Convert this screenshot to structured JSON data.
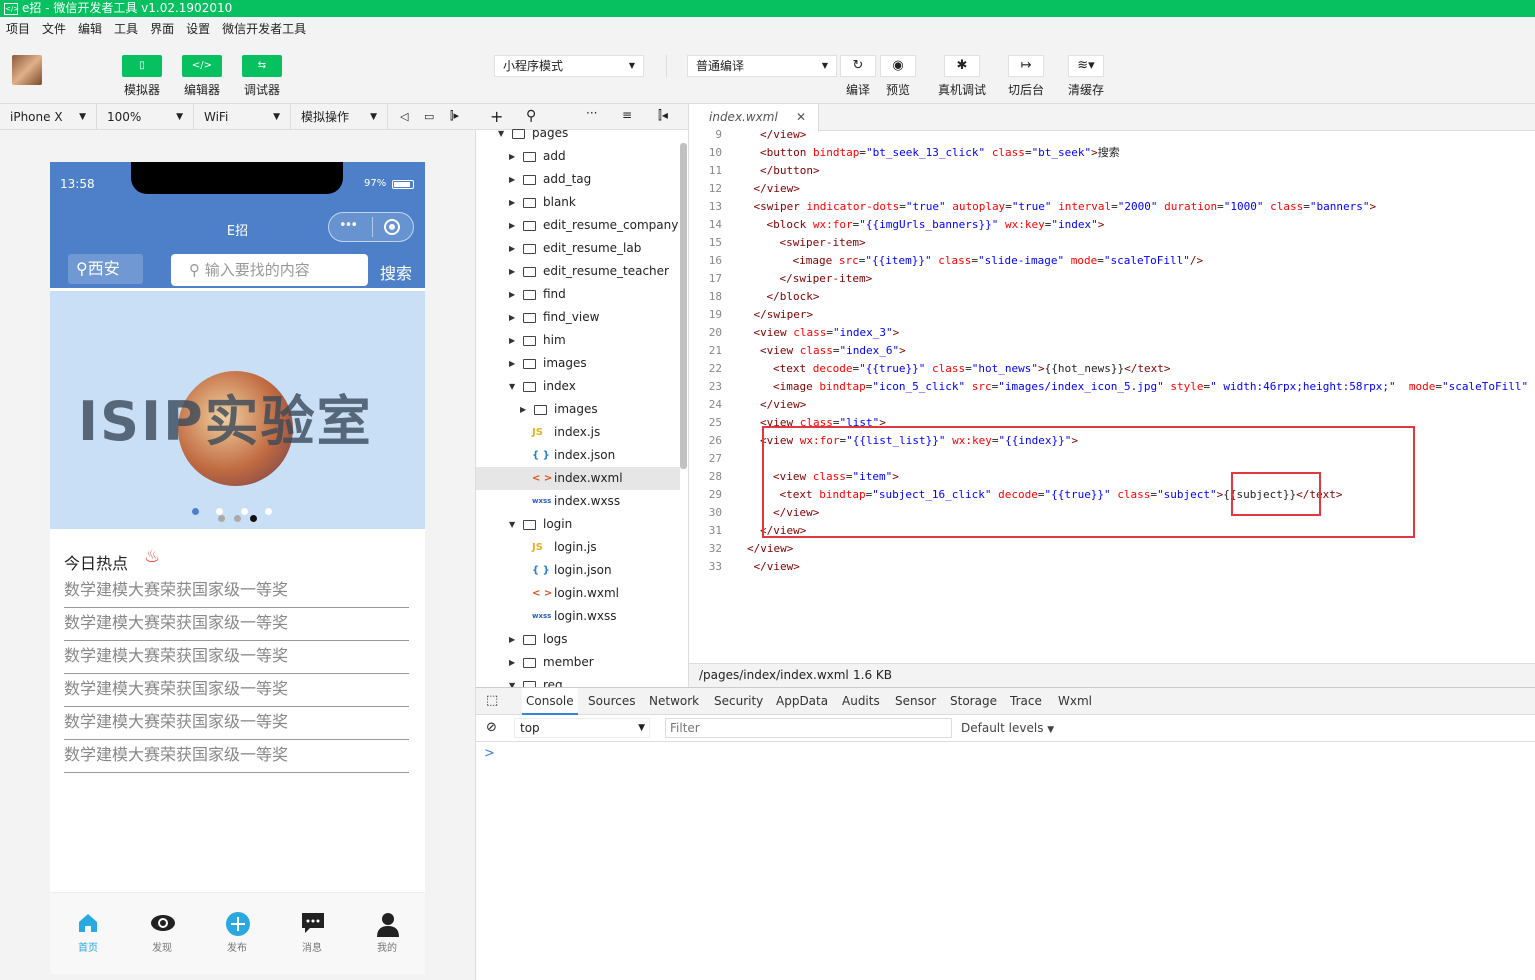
{
  "window": {
    "title": "e招 - 微信开发者工具 v1.02.1902010"
  },
  "menu": [
    "项目",
    "文件",
    "编辑",
    "工具",
    "界面",
    "设置",
    "微信开发者工具"
  ],
  "toolbar": {
    "simulator": "模拟器",
    "editor": "编辑器",
    "debugger": "调试器",
    "mode": "小程序模式",
    "compile_mode": "普通编译",
    "compile": "编译",
    "preview": "预览",
    "remote_debug": "真机调试",
    "background": "切后台",
    "clear_cache": "清缓存"
  },
  "simbar": {
    "device": "iPhone X",
    "zoom": "100%",
    "network": "WiFi",
    "ops": "模拟操作"
  },
  "phone": {
    "time": "13:58",
    "battery": "97%",
    "nav_title": "E招",
    "city": "西安",
    "search_placeholder": "输入要找的内容",
    "search_button": "搜索",
    "banner_text": "ISIP实验室",
    "hot_title": "今日热点",
    "news": [
      "数学建模大赛荣获国家级一等奖",
      "数学建模大赛荣获国家级一等奖",
      "数学建模大赛荣获国家级一等奖",
      "数学建模大赛荣获国家级一等奖",
      "数学建模大赛荣获国家级一等奖",
      "数学建模大赛荣获国家级一等奖"
    ],
    "tabs": [
      "首页",
      "发现",
      "发布",
      "消息",
      "我的"
    ],
    "accent": "#4d80c8",
    "tab_active": "#1aad19"
  },
  "tree": [
    {
      "name": "pages",
      "type": "folder",
      "open": true,
      "depth": 0
    },
    {
      "name": "add",
      "type": "folder",
      "open": false,
      "depth": 1
    },
    {
      "name": "add_tag",
      "type": "folder",
      "open": false,
      "depth": 1
    },
    {
      "name": "blank",
      "type": "folder",
      "open": false,
      "depth": 1
    },
    {
      "name": "edit_resume_company",
      "type": "folder",
      "open": false,
      "depth": 1
    },
    {
      "name": "edit_resume_lab",
      "type": "folder",
      "open": false,
      "depth": 1
    },
    {
      "name": "edit_resume_teacher",
      "type": "folder",
      "open": false,
      "depth": 1
    },
    {
      "name": "find",
      "type": "folder",
      "open": false,
      "depth": 1
    },
    {
      "name": "find_view",
      "type": "folder",
      "open": false,
      "depth": 1
    },
    {
      "name": "him",
      "type": "folder",
      "open": false,
      "depth": 1
    },
    {
      "name": "images",
      "type": "folder",
      "open": false,
      "depth": 1
    },
    {
      "name": "index",
      "type": "folder",
      "open": true,
      "depth": 1
    },
    {
      "name": "images",
      "type": "folder",
      "open": false,
      "depth": 2
    },
    {
      "name": "index.js",
      "type": "js",
      "depth": 2
    },
    {
      "name": "index.json",
      "type": "json",
      "depth": 2
    },
    {
      "name": "index.wxml",
      "type": "wxml",
      "depth": 2,
      "selected": true
    },
    {
      "name": "index.wxss",
      "type": "wxss",
      "depth": 2
    },
    {
      "name": "login",
      "type": "folder",
      "open": true,
      "depth": 1
    },
    {
      "name": "login.js",
      "type": "js",
      "depth": 2
    },
    {
      "name": "login.json",
      "type": "json",
      "depth": 2
    },
    {
      "name": "login.wxml",
      "type": "wxml",
      "depth": 2
    },
    {
      "name": "login.wxss",
      "type": "wxss",
      "depth": 2
    },
    {
      "name": "logs",
      "type": "folder",
      "open": false,
      "depth": 1
    },
    {
      "name": "member",
      "type": "folder",
      "open": false,
      "depth": 1
    },
    {
      "name": "reg",
      "type": "folder",
      "open": true,
      "depth": 1
    }
  ],
  "editor": {
    "tab": "index.wxml",
    "path": "/pages/index/index.wxml",
    "size": "1.6 KB",
    "lines": [
      {
        "n": "9",
        "indent": 2,
        "html": "<span class='t'>&lt;/view&gt;</span>"
      },
      {
        "n": "10",
        "indent": 2,
        "html": "<span class='t'>&lt;button</span> <span class='a'>bindtap</span>=<span class='v'>\"bt_seek_13_click\"</span> <span class='a'>class</span>=<span class='v'>\"bt_seek\"</span><span class='t'>&gt;</span>搜索"
      },
      {
        "n": "11",
        "indent": 2,
        "html": "<span class='t'>&lt;/button&gt;</span>"
      },
      {
        "n": "12",
        "indent": 1,
        "html": "<span class='t'>&lt;/view&gt;</span>"
      },
      {
        "n": "13",
        "indent": 1,
        "html": "<span class='t'>&lt;swiper</span> <span class='a'>indicator-dots</span>=<span class='v'>\"true\"</span> <span class='a'>autoplay</span>=<span class='v'>\"true\"</span> <span class='a'>interval</span>=<span class='v'>\"2000\"</span> <span class='a'>duration</span>=<span class='v'>\"1000\"</span> <span class='a'>class</span>=<span class='v'>\"banners\"</span><span class='t'>&gt;</span>"
      },
      {
        "n": "14",
        "indent": 3,
        "html": "<span class='t'>&lt;block</span> <span class='a'>wx:for</span>=<span class='v'>\"{{imgUrls_banners}}\"</span> <span class='a'>wx:key</span>=<span class='v'>\"index\"</span><span class='t'>&gt;</span>"
      },
      {
        "n": "15",
        "indent": 5,
        "html": "<span class='t'>&lt;swiper-item&gt;</span>"
      },
      {
        "n": "16",
        "indent": 7,
        "html": "<span class='t'>&lt;image</span> <span class='a'>src</span>=<span class='v'>\"{{item}}\"</span> <span class='a'>class</span>=<span class='v'>\"slide-image\"</span> <span class='a'>mode</span>=<span class='v'>\"scaleToFill\"</span><span class='t'>/&gt;</span>"
      },
      {
        "n": "17",
        "indent": 5,
        "html": "<span class='t'>&lt;/swiper-item&gt;</span>"
      },
      {
        "n": "18",
        "indent": 3,
        "html": "<span class='t'>&lt;/block&gt;</span>"
      },
      {
        "n": "19",
        "indent": 1,
        "html": "<span class='t'>&lt;/swiper&gt;</span>"
      },
      {
        "n": "20",
        "indent": 1,
        "html": "<span class='t'>&lt;view</span> <span class='a'>class</span>=<span class='v'>\"index_3\"</span><span class='t'>&gt;</span>"
      },
      {
        "n": "21",
        "indent": 2,
        "html": "<span class='t'>&lt;view</span> <span class='a'>class</span>=<span class='v'>\"index_6\"</span><span class='t'>&gt;</span>"
      },
      {
        "n": "22",
        "indent": 4,
        "html": "<span class='t'>&lt;text</span> <span class='a'>decode</span>=<span class='v'>\"{{true}}\"</span> <span class='a'>class</span>=<span class='v'>\"hot_news\"</span><span class='t'>&gt;</span>{{hot_news}}<span class='t'>&lt;/text&gt;</span>"
      },
      {
        "n": "23",
        "indent": 4,
        "html": "<span class='t'>&lt;image</span> <span class='a'>bindtap</span>=<span class='v'>\"icon_5_click\"</span> <span class='a'>src</span>=<span class='v'>\"images/index_icon_5.jpg\"</span> <span class='a'>style</span>=<span class='v'>\" width:46rpx;height:58rpx;\"</span>  <span class='a'>mode</span>=<span class='v'>\"scaleToFill\"</span>"
      },
      {
        "n": "24",
        "indent": 2,
        "html": "<span class='t'>&lt;/view&gt;</span>"
      },
      {
        "n": "25",
        "indent": 2,
        "html": "<span class='t'>&lt;view</span> <span class='a'>class</span>=<span class='v'>\"list\"</span><span class='t'>&gt;</span>"
      },
      {
        "n": "26",
        "indent": 2,
        "html": "<span class='t'>&lt;view</span> <span class='a'>wx:for</span>=<span class='v'>\"{{list_list}}\"</span> <span class='a'>wx:key</span>=<span class='v'>\"{{index}}\"</span><span class='t'>&gt;</span>"
      },
      {
        "n": "27",
        "indent": 2,
        "html": ""
      },
      {
        "n": "28",
        "indent": 4,
        "html": "<span class='t'>&lt;view</span> <span class='a'>class</span>=<span class='v'>\"item\"</span><span class='t'>&gt;</span>"
      },
      {
        "n": "29",
        "indent": 5,
        "html": "<span class='t'>&lt;text</span> <span class='a'>bindtap</span>=<span class='v'>\"subject_16_click\"</span> <span class='a'>decode</span>=<span class='v'>\"{{true}}\"</span> <span class='a'>class</span>=<span class='v'>\"subject\"</span><span class='t'>&gt;</span>{{subject}}<span class='t'>&lt;/text&gt;</span>"
      },
      {
        "n": "30",
        "indent": 4,
        "html": "<span class='t'>&lt;/view&gt;</span>"
      },
      {
        "n": "31",
        "indent": 2,
        "html": "<span class='t'>&lt;/view&gt;</span>"
      },
      {
        "n": "32",
        "indent": 0,
        "html": "<span class='t'>&lt;/view&gt;</span>"
      },
      {
        "n": "33",
        "indent": 1,
        "html": "<span class='t'>&lt;/view&gt;</span>"
      }
    ]
  },
  "devtools": {
    "tabs": [
      "Console",
      "Sources",
      "Network",
      "Security",
      "AppData",
      "Audits",
      "Sensor",
      "Storage",
      "Trace",
      "Wxml"
    ],
    "active_tab": "Console",
    "context": "top",
    "filter_placeholder": "Filter",
    "levels": "Default levels",
    "prompt": ">"
  }
}
